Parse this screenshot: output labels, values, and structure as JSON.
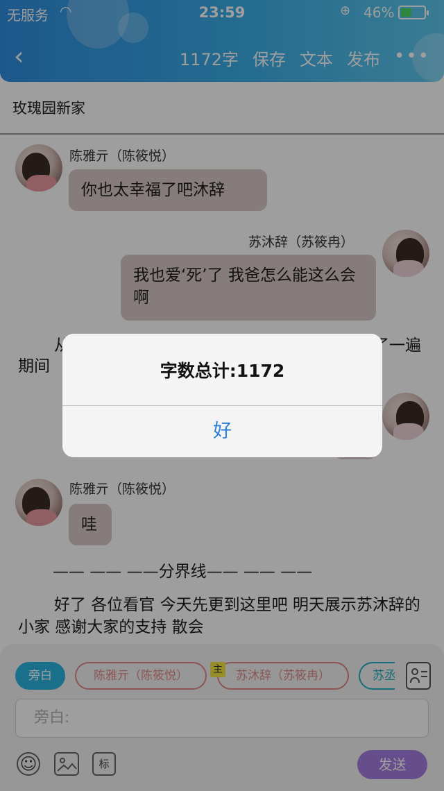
{
  "status": {
    "carrier": "无服务",
    "time": "23:59",
    "battery_pct": "46%",
    "battery_level": 0.46
  },
  "nav": {
    "back_icon": "‹",
    "word_count": "1172字",
    "save": "保存",
    "text": "文本",
    "publish": "发布",
    "more_icon": "•••"
  },
  "doc_title": "玫瑰园新家",
  "messages": [
    {
      "speaker": "陈雅亓（陈筱悦）",
      "text": "你也太幸福了吧沐辞"
    },
    {
      "speaker": "苏沐辞（苏筱冉）",
      "text": "我也爱‘死’了 我爸怎么能这么会啊"
    }
  ],
  "narration_fragment_1": "从",
  "narration_fragment_2": "期间",
  "narration_fragment_3": "了一遍",
  "message3": {
    "speaker": "陈雅亓（陈筱悦）",
    "text": "哇"
  },
  "divider": "—— —— ——分界线—— —— ——",
  "closing": "好了 各位看官 今天先更到这里吧 明天展示苏沐辞的小家 感谢大家的支持 散会",
  "alert": {
    "message": "字数总计:1172",
    "ok": "好"
  },
  "compose": {
    "chips": [
      "旁白",
      "陈雅亓（陈筱悦）",
      "苏沐辞（苏筱冉）",
      "苏丞"
    ],
    "owner_tag": "主",
    "input_placeholder": "旁白:",
    "emoji_icon": "☺",
    "label_tool": "标",
    "send": "发送"
  }
}
